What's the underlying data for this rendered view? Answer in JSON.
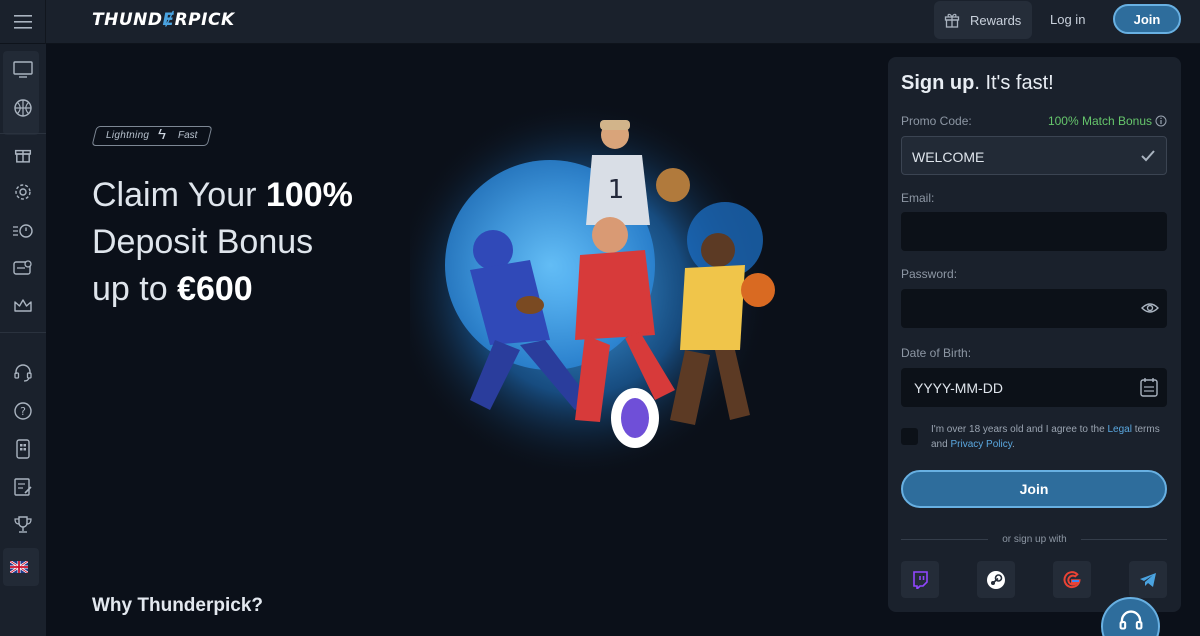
{
  "brand": {
    "logo_pre": "THUND",
    "logo_bolt": "Ɇ",
    "logo_post": "RPICK"
  },
  "header": {
    "rewards_label": "Rewards",
    "login_label": "Log in",
    "join_label": "Join"
  },
  "sidebar": {
    "items": [
      "tv-icon",
      "basketball-icon",
      "gift-icon",
      "gear-icon",
      "stopwatch-icon",
      "ticket-icon",
      "crown-icon",
      "headset-icon",
      "help-icon",
      "phone-app-icon",
      "notes-icon",
      "trophy-icon",
      "uk-flag-icon"
    ]
  },
  "hero": {
    "badge_left": "Lightning",
    "badge_right": "Fast",
    "line1_regular": "Claim Your ",
    "line1_bold": "100%",
    "line2": "Deposit Bonus",
    "line3_regular": "up to ",
    "line3_bold": "€600",
    "why_heading": "Why Thunderpick?"
  },
  "signup": {
    "title_bold": "Sign up",
    "title_rest": ". It's fast!",
    "promo_label": "Promo Code:",
    "promo_bonus": "100% Match Bonus",
    "promo_value": "WELCOME",
    "email_label": "Email:",
    "password_label": "Password:",
    "dob_label": "Date of Birth:",
    "dob_placeholder": "YYYY-MM-DD",
    "agree_text_1": "I'm over 18 years old and I agree to the ",
    "agree_link_legal": "Legal",
    "agree_text_2": " terms and ",
    "agree_link_privacy": "Privacy Policy",
    "agree_text_3": ".",
    "join_label": "Join",
    "or_text": "or sign up with",
    "social": [
      "twitch-icon",
      "steam-icon",
      "google-icon",
      "telegram-icon"
    ]
  },
  "colors": {
    "accent": "#2e6d9c",
    "accent_border": "#68b0e2",
    "bonus_green": "#66c66c",
    "panel": "#1a212c",
    "background": "#0b1019"
  }
}
